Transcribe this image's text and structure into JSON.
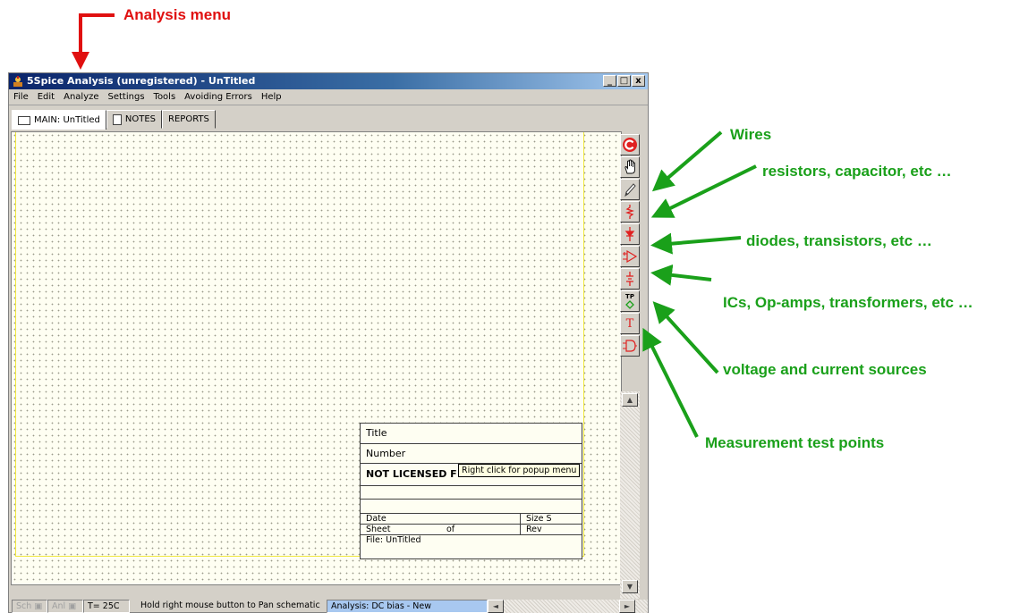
{
  "callouts": {
    "analysis_menu": "Analysis menu",
    "wires": "Wires",
    "resistors": "resistors, capacitor, etc …",
    "diodes": "diodes, transistors, etc …",
    "ics": "ICs, Op-amps, transformers, etc …",
    "sources": "voltage and current sources",
    "test_points": "Measurement test points"
  },
  "colors": {
    "callout_green": "#1aa01a",
    "callout_red": "#e01010",
    "component_red": "#e02020"
  },
  "window": {
    "title": "5Spice Analysis (unregistered) - UnTitled",
    "controls": [
      "_",
      "□",
      "x"
    ]
  },
  "menu": [
    "File",
    "Edit",
    "Analyze",
    "Settings",
    "Tools",
    "Avoiding Errors",
    "Help"
  ],
  "tabs": [
    {
      "label": "MAIN: UnTitled",
      "icon": "schematic-icon"
    },
    {
      "label": "NOTES",
      "icon": "notepad-icon"
    },
    {
      "label": "REPORTS",
      "icon": "none"
    }
  ],
  "title_block": {
    "title": "Title",
    "number": "Number",
    "license": "NOT LICENSED F",
    "tooltip": "Right click for popup menu",
    "date": "Date",
    "size": "Size  S",
    "sheet": "Sheet",
    "of": "of",
    "rev": "Rev",
    "file": "File:  UnTitled"
  },
  "toolbar_icons": [
    "redraw-icon",
    "hand-pan-icon",
    "wire-pencil-icon",
    "resistor-icon",
    "diode-icon",
    "opamp-icon",
    "source-icon",
    "test-point-icon",
    "text-icon",
    "logic-gate-icon"
  ],
  "toolbar_glyphs": {
    "test_point": "TP",
    "text": "T"
  },
  "status": {
    "sch": "Sch",
    "anl": "Anl",
    "temp": "T= 25C",
    "hint": "Hold right mouse button to Pan schematic",
    "analysis": "Analysis:  DC bias - New"
  },
  "scroll": {
    "up": "▲",
    "down": "▼",
    "left": "◄",
    "right": "►"
  }
}
